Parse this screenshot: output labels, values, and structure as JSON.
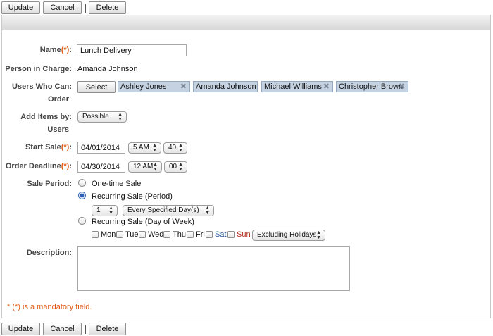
{
  "toolbar_top": {
    "update": "Update",
    "cancel": "Cancel",
    "delete": "Delete"
  },
  "toolbar_bottom": {
    "update": "Update",
    "cancel": "Cancel",
    "delete": "Delete"
  },
  "form": {
    "name": {
      "label": "Name",
      "required_mark": "(*)",
      "value": "Lunch Delivery"
    },
    "person_in_charge": {
      "label": "Person in Charge",
      "value": "Amanda Johnson"
    },
    "users_who_can_order": {
      "label_line1": "Users Who Can",
      "label_line2": "Order",
      "select_button": "Select",
      "users": [
        "Ashley Jones",
        "Amanda Johnson",
        "Michael Williams",
        "Christopher Brown"
      ]
    },
    "add_items_by_users": {
      "label_line1": "Add Items by",
      "label_line2": "Users",
      "value": "Possible"
    },
    "start_sale": {
      "label": "Start Sale",
      "required_mark": "(*)",
      "date": "04/01/2014",
      "hour": "5 AM",
      "minute": "40"
    },
    "order_deadline": {
      "label": "Order Deadline",
      "required_mark": "(*)",
      "date": "04/30/2014",
      "hour": "12 AM",
      "minute": "00"
    },
    "sale_period": {
      "label": "Sale Period",
      "options": [
        "One-time Sale",
        "Recurring Sale (Period)",
        "Recurring Sale (Day of Week)"
      ],
      "selected_index": 1,
      "period_count": "1",
      "period_unit": "Every Specified Day(s)",
      "days": [
        "Mon",
        "Tue",
        "Wed",
        "Thu",
        "Fri",
        "Sat",
        "Sun"
      ],
      "day_colors": {
        "Sat": "#2d5a9c",
        "Sun": "#b02a1a"
      },
      "holiday_option": "Excluding Holidays"
    },
    "description": {
      "label": "Description",
      "value": ""
    }
  },
  "mandatory_note": "(*) is a mandatory field.",
  "separator": ":",
  "colors": {
    "required": "#e05a12",
    "chip_bg": "#c4d2e2",
    "radio_selected": "#2b5fb0"
  }
}
